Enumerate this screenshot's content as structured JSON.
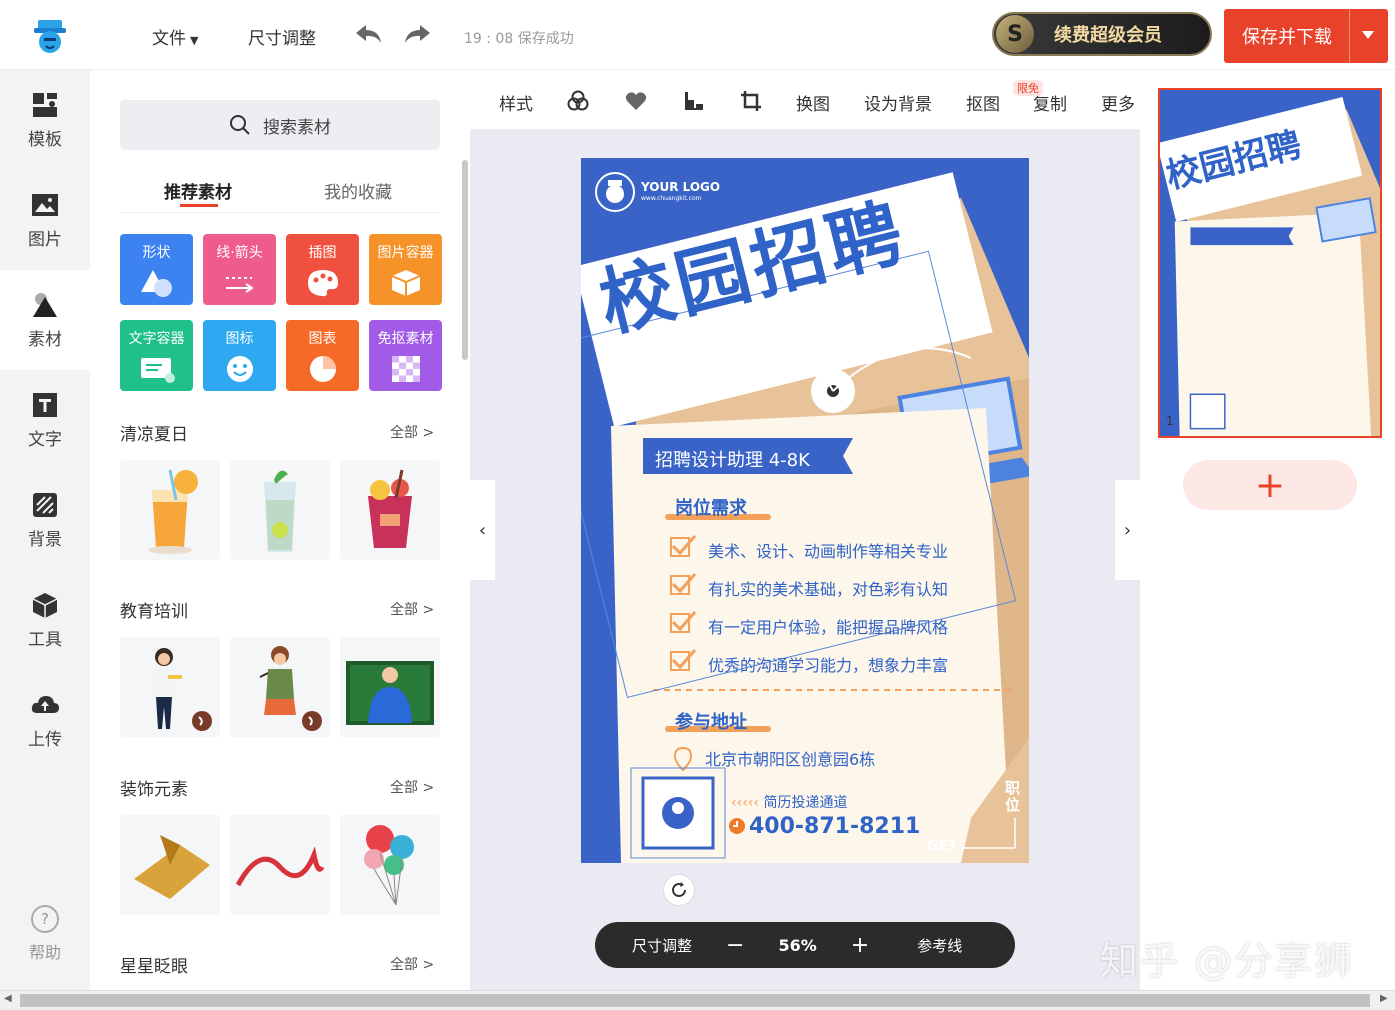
{
  "topbar": {
    "menu_file": "文件",
    "menu_resize": "尺寸调整",
    "save_status": "19 : 08 保存成功",
    "vip_badge": "S",
    "vip_label": "续费超级会员",
    "save_download": "保存并下载"
  },
  "leftnav": {
    "items": [
      {
        "label": "模板",
        "icon": "template-icon"
      },
      {
        "label": "图片",
        "icon": "image-icon"
      },
      {
        "label": "素材",
        "icon": "shapes-icon"
      },
      {
        "label": "文字",
        "icon": "text-icon"
      },
      {
        "label": "背景",
        "icon": "background-icon"
      },
      {
        "label": "工具",
        "icon": "tools-icon"
      },
      {
        "label": "上传",
        "icon": "upload-cloud-icon"
      }
    ],
    "help_icon": "?",
    "help": "帮助"
  },
  "panel": {
    "search_placeholder": "搜索素材",
    "tabs": [
      "推荐素材",
      "我的收藏"
    ],
    "categories": [
      {
        "label": "形状",
        "color": "#3c82f0"
      },
      {
        "label": "线·箭头",
        "color": "#ee5c8c"
      },
      {
        "label": "插图",
        "color": "#f0513e"
      },
      {
        "label": "图片容器",
        "color": "#f5922a"
      },
      {
        "label": "文字容器",
        "color": "#1fc08a"
      },
      {
        "label": "图标",
        "color": "#2ea8f0"
      },
      {
        "label": "图表",
        "color": "#f56a26"
      },
      {
        "label": "免抠素材",
        "color": "#a15be6"
      }
    ],
    "sections": [
      {
        "title": "清凉夏日",
        "all": "全部 >"
      },
      {
        "title": "教育培训",
        "all": "全部 >"
      },
      {
        "title": "装饰元素",
        "all": "全部 >"
      },
      {
        "title": "星星眨眼",
        "all": "全部 >"
      }
    ]
  },
  "toolbar2": {
    "style": "样式",
    "replace": "换图",
    "set_bg": "设为背景",
    "cutout": "抠图",
    "limited": "限免",
    "copy": "复制",
    "more": "更多"
  },
  "poster": {
    "logo_main": "YOUR LOGO",
    "logo_sub": "www.chuangkit.com",
    "title": "校园招聘",
    "position": "招聘设计助理 4-8K",
    "req_title": "岗位需求",
    "reqs": [
      "美术、设计、动画制作等相关专业",
      "有扎实的美术基础，对色彩有认知",
      "有一定用户体验，能把握品牌风格",
      "优秀的沟通学习能力，想象力丰富"
    ],
    "addr_title": "参与地址",
    "address": "北京市朝阳区创意园6栋",
    "resume_channel": "简历投递通道",
    "phone": "400-871-8211",
    "side_text": "职位",
    "get": "GET"
  },
  "zoombar": {
    "resize": "尺寸调整",
    "minus": "−",
    "zoom": "56%",
    "plus": "+",
    "guides": "参考线"
  },
  "rightpanel": {
    "page_number": "1",
    "add_page": "+"
  },
  "watermark": "知乎 @分享狮",
  "colors": {
    "accent": "#e8422a",
    "poster_blue": "#3a63c8",
    "poster_tan": "#e8c39a"
  }
}
